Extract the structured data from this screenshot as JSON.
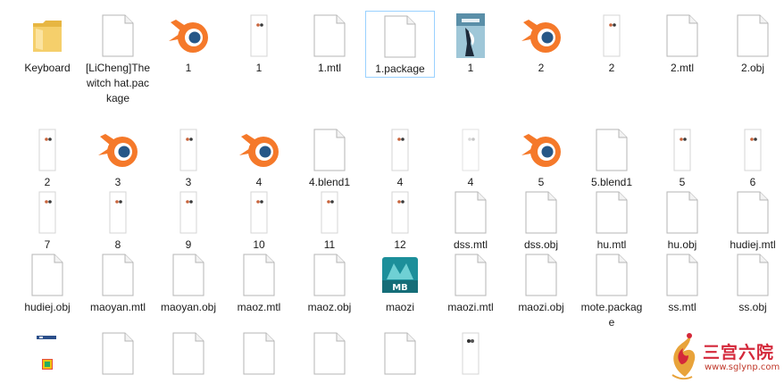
{
  "items": [
    {
      "label": "Keyboard",
      "icon": "folder"
    },
    {
      "label": "[LiCheng]The witch hat.package",
      "icon": "blank"
    },
    {
      "label": "1",
      "icon": "blender"
    },
    {
      "label": "1",
      "icon": "texture"
    },
    {
      "label": "1.mtl",
      "icon": "blank"
    },
    {
      "label": "1.package",
      "icon": "blank",
      "selected": true
    },
    {
      "label": "1",
      "icon": "photo"
    },
    {
      "label": "2",
      "icon": "blender"
    },
    {
      "label": "2",
      "icon": "texture"
    },
    {
      "label": "2.mtl",
      "icon": "blank"
    },
    {
      "label": "2.obj",
      "icon": "blank"
    },
    {
      "label": "2",
      "icon": "texture"
    },
    {
      "label": "3",
      "icon": "blender"
    },
    {
      "label": "3",
      "icon": "texture"
    },
    {
      "label": "4",
      "icon": "blender"
    },
    {
      "label": "4.blend1",
      "icon": "blank"
    },
    {
      "label": "4",
      "icon": "texture"
    },
    {
      "label": "4",
      "icon": "texture-light"
    },
    {
      "label": "5",
      "icon": "blender"
    },
    {
      "label": "5.blend1",
      "icon": "blank"
    },
    {
      "label": "5",
      "icon": "texture"
    },
    {
      "label": "6",
      "icon": "texture"
    },
    {
      "label": "7",
      "icon": "texture"
    },
    {
      "label": "8",
      "icon": "texture"
    },
    {
      "label": "9",
      "icon": "texture"
    },
    {
      "label": "10",
      "icon": "texture"
    },
    {
      "label": "11",
      "icon": "texture"
    },
    {
      "label": "12",
      "icon": "texture"
    },
    {
      "label": "dss.mtl",
      "icon": "blank"
    },
    {
      "label": "dss.obj",
      "icon": "blank"
    },
    {
      "label": "hu.mtl",
      "icon": "blank"
    },
    {
      "label": "hu.obj",
      "icon": "blank"
    },
    {
      "label": "hudiej.mtl",
      "icon": "blank"
    },
    {
      "label": "hudiej.obj",
      "icon": "blank"
    },
    {
      "label": "maoyan.mtl",
      "icon": "blank"
    },
    {
      "label": "maoyan.obj",
      "icon": "blank"
    },
    {
      "label": "maoz.mtl",
      "icon": "blank"
    },
    {
      "label": "maoz.obj",
      "icon": "blank"
    },
    {
      "label": "maozi",
      "icon": "maya"
    },
    {
      "label": "maozi.mtl",
      "icon": "blank"
    },
    {
      "label": "maozi.obj",
      "icon": "blank"
    },
    {
      "label": "mote.package",
      "icon": "blank"
    },
    {
      "label": "ss.mtl",
      "icon": "blank"
    },
    {
      "label": "ss.obj",
      "icon": "blank"
    },
    {
      "label": "",
      "icon": "thumb-small"
    },
    {
      "label": "",
      "icon": "blank"
    },
    {
      "label": "",
      "icon": "blank"
    },
    {
      "label": "",
      "icon": "blank"
    },
    {
      "label": "",
      "icon": "blank"
    },
    {
      "label": "",
      "icon": "blank"
    },
    {
      "label": "",
      "icon": "texture-dark"
    }
  ],
  "maya_badge": "MB",
  "watermark": {
    "title": "三宫六院",
    "url": "www.sglynp.com"
  },
  "colors": {
    "folder": "#f0c65a",
    "blender_orange": "#f5792a",
    "blender_blue": "#265787",
    "maya_teal": "#1c8f9a",
    "selection_border": "#99d1ff",
    "watermark_red": "#d4283a"
  }
}
